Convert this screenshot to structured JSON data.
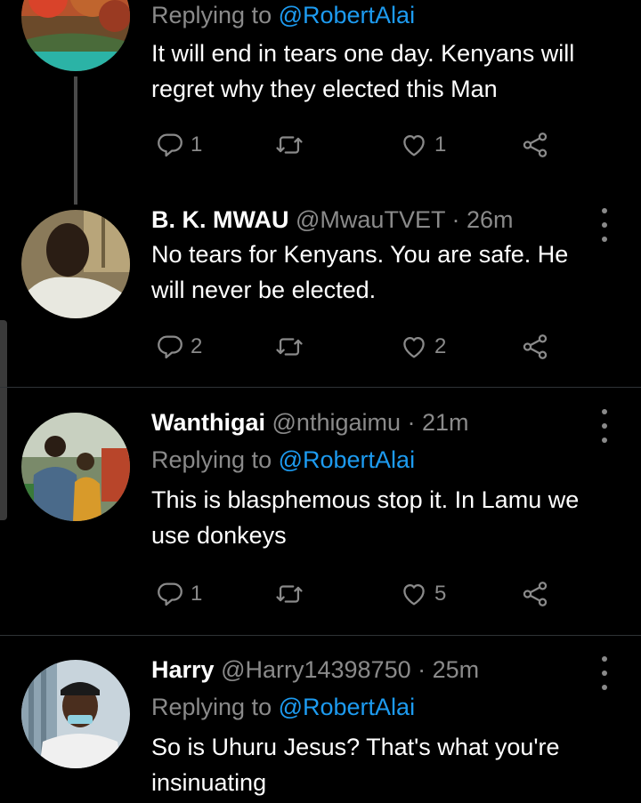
{
  "tweets": [
    {
      "reply_prefix": "Replying to ",
      "reply_handle": "@RobertAlai",
      "text": "It will end in tears one day. Kenyans will regret why they elected this Man",
      "reply_count": "1",
      "like_count": "1"
    },
    {
      "name": "B. K. MWAU",
      "handle": "@MwauTVET",
      "time": " · 26m",
      "text": "No tears for Kenyans. You are safe. He will never be elected.",
      "reply_count": "2",
      "like_count": "2"
    },
    {
      "name": "Wanthigai",
      "handle": "@nthigaimu",
      "time": " · 21m",
      "reply_prefix": "Replying to ",
      "reply_handle": "@RobertAlai",
      "text": "This is blasphemous stop it. In Lamu we use donkeys",
      "reply_count": "1",
      "like_count": "5"
    },
    {
      "name": "Harry",
      "handle": "@Harry14398750",
      "time": " · 25m",
      "reply_prefix": "Replying to ",
      "reply_handle": "@RobertAlai",
      "text": "So is Uhuru Jesus? That's what you're insinuating"
    }
  ],
  "icons": {
    "reply": "reply-icon",
    "retweet": "retweet-icon",
    "like": "heart-icon",
    "share": "share-icon",
    "more": "more-vertical-icon"
  },
  "colors": {
    "background": "#000000",
    "text": "#ffffff",
    "secondary": "#8a8a8a",
    "mention": "#1d9bf0"
  }
}
